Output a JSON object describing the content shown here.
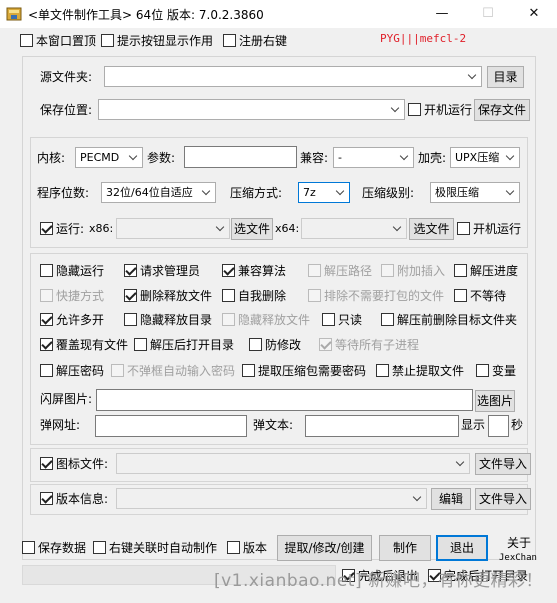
{
  "window": {
    "title": "<单文件制作工具> 64位 版本: 7.0.2.3860",
    "minimize": "—",
    "maximize": "☐",
    "close": "✕"
  },
  "top_options": {
    "topmost": "本窗口置顶",
    "show_tips": "提示按钮显示作用",
    "register_rightclick": "注册右键",
    "author_tag": "PYG|||mefcl-2"
  },
  "source": {
    "src_folder_label": "源文件夹:",
    "src_folder_value": "",
    "dir_button": "目录",
    "save_label": "保存位置:",
    "save_value": "",
    "autorun_label": "开机运行",
    "save_file_button": "保存文件"
  },
  "kernel": {
    "kernel_label": "内核:",
    "kernel_value": "PECMD",
    "param_label": "参数:",
    "param_value": "",
    "compat_label": "兼容:",
    "compat_value": "-",
    "shell_label": "加壳:",
    "shell_value": "UPX压缩",
    "bits_label": "程序位数:",
    "bits_value": "32位/64位自适应",
    "comp_method_label": "压缩方式:",
    "comp_method_value": "7z",
    "comp_level_label": "压缩级别:",
    "comp_level_value": "极限压缩",
    "run_label": "运行:",
    "x86_label": "x86:",
    "x86_value": "",
    "select_file_1": "选文件",
    "x64_label": "x64:",
    "x64_value": "",
    "select_file_2": "选文件",
    "boot_run": "开机运行"
  },
  "options": {
    "row1": [
      "隐藏运行",
      "请求管理员",
      "兼容算法",
      "解压路径",
      "附加插入",
      "解压进度"
    ],
    "row2": [
      "快捷方式",
      "删除释放文件",
      "自我删除",
      "排除不需要打包的文件",
      "不等待"
    ],
    "row3": [
      "允许多开",
      "隐藏释放目录",
      "隐藏释放文件",
      "只读",
      "解压前删除目标文件夹"
    ],
    "row4": [
      "覆盖现有文件",
      "解压后打开目录",
      "防修改",
      "等待所有子进程"
    ],
    "row5": [
      "解压密码",
      "不弹框自动输入密码",
      "提取压缩包需要密码",
      "禁止提取文件",
      "变量"
    ],
    "splash_label": "闪屏图片:",
    "select_image": "选图片",
    "popup_url_label": "弹网址:",
    "popup_text_label": "弹文本:",
    "show_label": "显示",
    "seconds_label": "秒"
  },
  "icon_section": {
    "icon_label": "图标文件:",
    "icon_value": "",
    "import_1": "文件导入"
  },
  "version_section": {
    "version_label": "版本信息:",
    "version_value": "",
    "edit_button": "编辑",
    "import_2": "文件导入"
  },
  "bottom": {
    "save_data": "保存数据",
    "right_click_make": "右键关联时自动制作",
    "version": "版本",
    "extract_button": "提取/修改/创建",
    "make_button": "制作",
    "exit_button": "退出",
    "about": "关于",
    "about_author": "JexChan",
    "exit_after_done": "完成后退出",
    "open_dir_after_done": "完成后打开目录",
    "watermark": "[v1.xianbao.net] 新赚吧，有你更精彩！"
  },
  "colors": {
    "accent": "#0078d7",
    "tag_red": "#e0202a",
    "background": "#f0f0f0"
  }
}
